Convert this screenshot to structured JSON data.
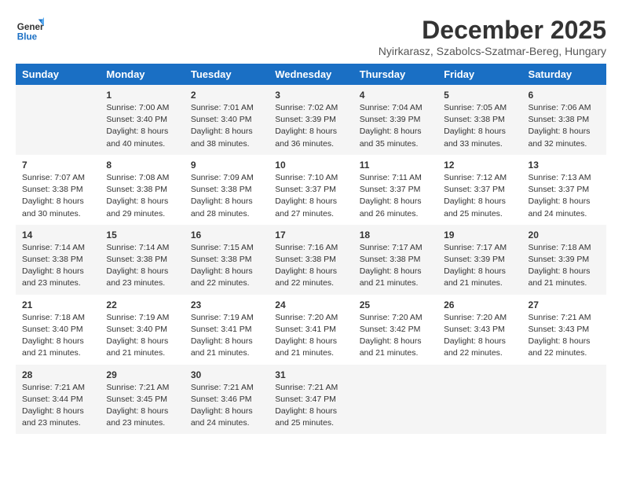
{
  "header": {
    "logo_line1": "General",
    "logo_line2": "Blue",
    "month_title": "December 2025",
    "location": "Nyirkarasz, Szabolcs-Szatmar-Bereg, Hungary"
  },
  "weekdays": [
    "Sunday",
    "Monday",
    "Tuesday",
    "Wednesday",
    "Thursday",
    "Friday",
    "Saturday"
  ],
  "weeks": [
    [
      {
        "day": "",
        "info": ""
      },
      {
        "day": "1",
        "info": "Sunrise: 7:00 AM\nSunset: 3:40 PM\nDaylight: 8 hours\nand 40 minutes."
      },
      {
        "day": "2",
        "info": "Sunrise: 7:01 AM\nSunset: 3:40 PM\nDaylight: 8 hours\nand 38 minutes."
      },
      {
        "day": "3",
        "info": "Sunrise: 7:02 AM\nSunset: 3:39 PM\nDaylight: 8 hours\nand 36 minutes."
      },
      {
        "day": "4",
        "info": "Sunrise: 7:04 AM\nSunset: 3:39 PM\nDaylight: 8 hours\nand 35 minutes."
      },
      {
        "day": "5",
        "info": "Sunrise: 7:05 AM\nSunset: 3:38 PM\nDaylight: 8 hours\nand 33 minutes."
      },
      {
        "day": "6",
        "info": "Sunrise: 7:06 AM\nSunset: 3:38 PM\nDaylight: 8 hours\nand 32 minutes."
      }
    ],
    [
      {
        "day": "7",
        "info": "Sunrise: 7:07 AM\nSunset: 3:38 PM\nDaylight: 8 hours\nand 30 minutes."
      },
      {
        "day": "8",
        "info": "Sunrise: 7:08 AM\nSunset: 3:38 PM\nDaylight: 8 hours\nand 29 minutes."
      },
      {
        "day": "9",
        "info": "Sunrise: 7:09 AM\nSunset: 3:38 PM\nDaylight: 8 hours\nand 28 minutes."
      },
      {
        "day": "10",
        "info": "Sunrise: 7:10 AM\nSunset: 3:37 PM\nDaylight: 8 hours\nand 27 minutes."
      },
      {
        "day": "11",
        "info": "Sunrise: 7:11 AM\nSunset: 3:37 PM\nDaylight: 8 hours\nand 26 minutes."
      },
      {
        "day": "12",
        "info": "Sunrise: 7:12 AM\nSunset: 3:37 PM\nDaylight: 8 hours\nand 25 minutes."
      },
      {
        "day": "13",
        "info": "Sunrise: 7:13 AM\nSunset: 3:37 PM\nDaylight: 8 hours\nand 24 minutes."
      }
    ],
    [
      {
        "day": "14",
        "info": "Sunrise: 7:14 AM\nSunset: 3:38 PM\nDaylight: 8 hours\nand 23 minutes."
      },
      {
        "day": "15",
        "info": "Sunrise: 7:14 AM\nSunset: 3:38 PM\nDaylight: 8 hours\nand 23 minutes."
      },
      {
        "day": "16",
        "info": "Sunrise: 7:15 AM\nSunset: 3:38 PM\nDaylight: 8 hours\nand 22 minutes."
      },
      {
        "day": "17",
        "info": "Sunrise: 7:16 AM\nSunset: 3:38 PM\nDaylight: 8 hours\nand 22 minutes."
      },
      {
        "day": "18",
        "info": "Sunrise: 7:17 AM\nSunset: 3:38 PM\nDaylight: 8 hours\nand 21 minutes."
      },
      {
        "day": "19",
        "info": "Sunrise: 7:17 AM\nSunset: 3:39 PM\nDaylight: 8 hours\nand 21 minutes."
      },
      {
        "day": "20",
        "info": "Sunrise: 7:18 AM\nSunset: 3:39 PM\nDaylight: 8 hours\nand 21 minutes."
      }
    ],
    [
      {
        "day": "21",
        "info": "Sunrise: 7:18 AM\nSunset: 3:40 PM\nDaylight: 8 hours\nand 21 minutes."
      },
      {
        "day": "22",
        "info": "Sunrise: 7:19 AM\nSunset: 3:40 PM\nDaylight: 8 hours\nand 21 minutes."
      },
      {
        "day": "23",
        "info": "Sunrise: 7:19 AM\nSunset: 3:41 PM\nDaylight: 8 hours\nand 21 minutes."
      },
      {
        "day": "24",
        "info": "Sunrise: 7:20 AM\nSunset: 3:41 PM\nDaylight: 8 hours\nand 21 minutes."
      },
      {
        "day": "25",
        "info": "Sunrise: 7:20 AM\nSunset: 3:42 PM\nDaylight: 8 hours\nand 21 minutes."
      },
      {
        "day": "26",
        "info": "Sunrise: 7:20 AM\nSunset: 3:43 PM\nDaylight: 8 hours\nand 22 minutes."
      },
      {
        "day": "27",
        "info": "Sunrise: 7:21 AM\nSunset: 3:43 PM\nDaylight: 8 hours\nand 22 minutes."
      }
    ],
    [
      {
        "day": "28",
        "info": "Sunrise: 7:21 AM\nSunset: 3:44 PM\nDaylight: 8 hours\nand 23 minutes."
      },
      {
        "day": "29",
        "info": "Sunrise: 7:21 AM\nSunset: 3:45 PM\nDaylight: 8 hours\nand 23 minutes."
      },
      {
        "day": "30",
        "info": "Sunrise: 7:21 AM\nSunset: 3:46 PM\nDaylight: 8 hours\nand 24 minutes."
      },
      {
        "day": "31",
        "info": "Sunrise: 7:21 AM\nSunset: 3:47 PM\nDaylight: 8 hours\nand 25 minutes."
      },
      {
        "day": "",
        "info": ""
      },
      {
        "day": "",
        "info": ""
      },
      {
        "day": "",
        "info": ""
      }
    ]
  ]
}
